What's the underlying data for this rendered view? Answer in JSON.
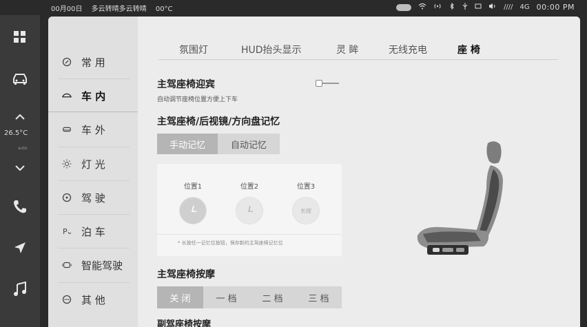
{
  "status": {
    "date": "00月00日",
    "weather": "多云转晴多云转晴",
    "temp": "00°C",
    "signal": "////",
    "network": "4G",
    "clock": "00:00 PM"
  },
  "dock": {
    "temp_value": "26.5°C",
    "temp_sub": "auto"
  },
  "menu": {
    "items": [
      {
        "label": "常 用",
        "icon": "clock-icon"
      },
      {
        "label": "车 内",
        "icon": "car-interior-icon"
      },
      {
        "label": "车 外",
        "icon": "car-exterior-icon"
      },
      {
        "label": "灯 光",
        "icon": "sun-icon"
      },
      {
        "label": "驾 驶",
        "icon": "steering-wheel-icon"
      },
      {
        "label": "泊 车",
        "icon": "parking-icon"
      },
      {
        "label": "智能驾驶",
        "icon": "sensor-icon"
      },
      {
        "label": "其 他",
        "icon": "more-icon"
      }
    ],
    "active_index": 1
  },
  "tabs": [
    "氛围灯",
    "HUD抬头显示",
    "灵 眸",
    "无线充电",
    "座 椅"
  ],
  "active_tab": 4,
  "seat_welcome": {
    "title": "主驾座椅迎宾",
    "subtitle": "自动调节座椅位置方便上下车",
    "enabled": false
  },
  "memory": {
    "title": "主驾座椅/后视镜/方向盘记忆",
    "modes": [
      "手动记忆",
      "自动记忆"
    ],
    "active_mode": 0,
    "positions": [
      "位置1",
      "位置2",
      "位置3"
    ],
    "position3_hint": "长按",
    "note": "* 长按任一记忆位按钮，保存新的主驾座椅记忆位"
  },
  "massage": {
    "title": "主驾座椅按摩",
    "levels": [
      "关 闭",
      "一 档",
      "二 档",
      "三 档"
    ],
    "active_level": 0
  },
  "next_section_title": "副驾座椅按摩",
  "colors": {
    "accent_segment": "#b5b5b5",
    "panel_bg": "#e9e9e9"
  }
}
